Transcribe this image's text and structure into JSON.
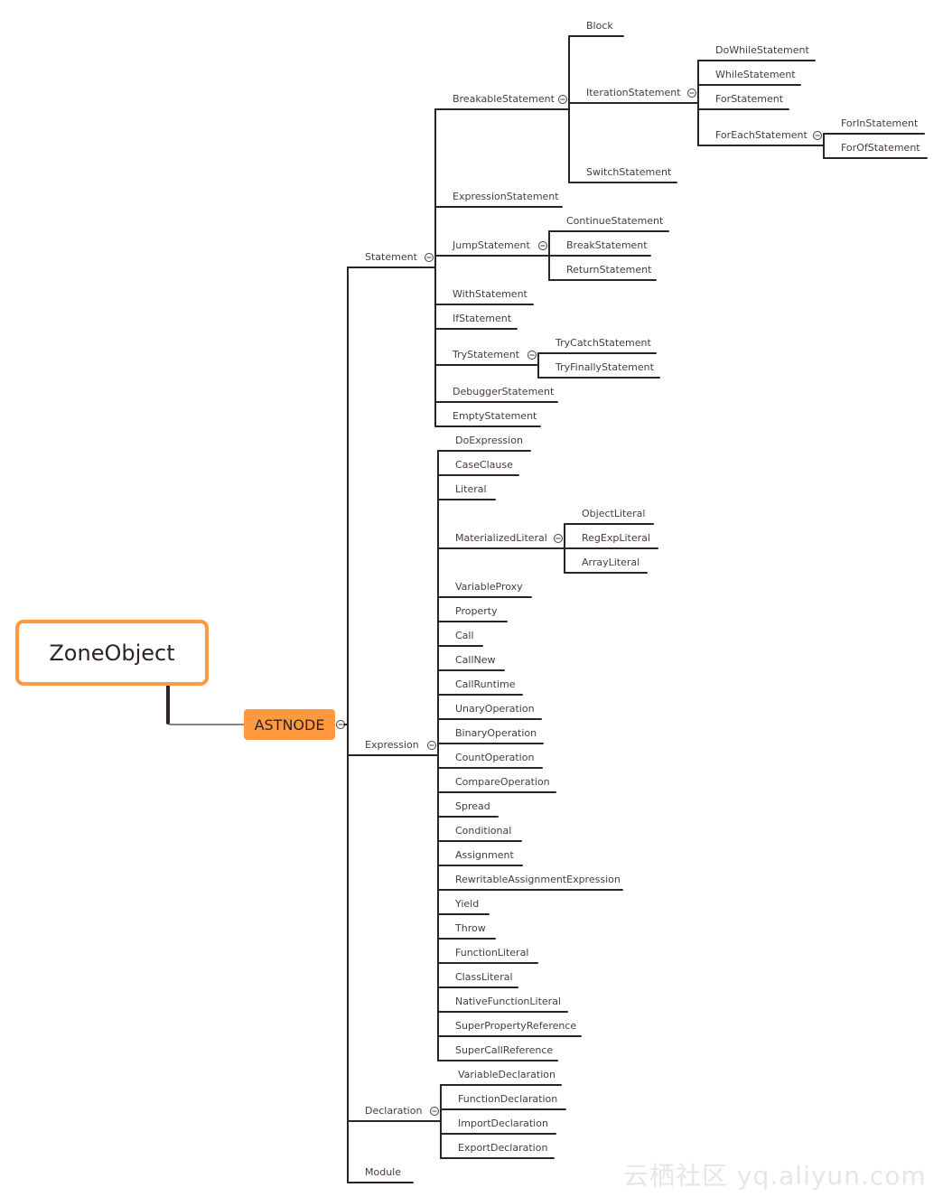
{
  "root": {
    "label": "ZoneObject",
    "border_color": "#ff9a40"
  },
  "main_topic": {
    "label": "ASTNODE",
    "fill_color": "#ff9a40"
  },
  "branches": [
    {
      "label": "Statement",
      "children": [
        {
          "label": "BreakableStatement",
          "children": [
            {
              "label": "Block"
            },
            {
              "label": "IterationStatement",
              "children": [
                {
                  "label": "DoWhileStatement"
                },
                {
                  "label": "WhileStatement"
                },
                {
                  "label": "ForStatement"
                },
                {
                  "label": "ForEachStatement",
                  "children": [
                    {
                      "label": "ForInStatement"
                    },
                    {
                      "label": "ForOfStatement"
                    }
                  ]
                }
              ]
            },
            {
              "label": "SwitchStatement"
            }
          ]
        },
        {
          "label": "ExpressionStatement"
        },
        {
          "label": "JumpStatement",
          "children": [
            {
              "label": "ContinueStatement"
            },
            {
              "label": "BreakStatement"
            },
            {
              "label": "ReturnStatement"
            }
          ]
        },
        {
          "label": "WithStatement"
        },
        {
          "label": "IfStatement"
        },
        {
          "label": "TryStatement",
          "children": [
            {
              "label": "TryCatchStatement"
            },
            {
              "label": "TryFinallyStatement"
            }
          ]
        },
        {
          "label": "DebuggerStatement"
        },
        {
          "label": "EmptyStatement"
        }
      ]
    },
    {
      "label": "Expression",
      "children": [
        {
          "label": "DoExpression"
        },
        {
          "label": "CaseClause"
        },
        {
          "label": "Literal"
        },
        {
          "label": "MaterializedLiteral",
          "children": [
            {
              "label": "ObjectLiteral"
            },
            {
              "label": "RegExpLiteral"
            },
            {
              "label": "ArrayLiteral"
            }
          ]
        },
        {
          "label": "VariableProxy"
        },
        {
          "label": "Property"
        },
        {
          "label": "Call"
        },
        {
          "label": "CallNew"
        },
        {
          "label": "CallRuntime"
        },
        {
          "label": "UnaryOperation"
        },
        {
          "label": "BinaryOperation"
        },
        {
          "label": "CountOperation"
        },
        {
          "label": "CompareOperation"
        },
        {
          "label": "Spread"
        },
        {
          "label": "Conditional"
        },
        {
          "label": "Assignment"
        },
        {
          "label": "RewritableAssignmentExpression"
        },
        {
          "label": "Yield"
        },
        {
          "label": "Throw"
        },
        {
          "label": "FunctionLiteral"
        },
        {
          "label": "ClassLiteral"
        },
        {
          "label": "NativeFunctionLiteral"
        },
        {
          "label": "SuperPropertyReference"
        },
        {
          "label": "SuperCallReference"
        }
      ]
    },
    {
      "label": "Declaration",
      "children": [
        {
          "label": "VariableDeclaration"
        },
        {
          "label": "FunctionDeclaration"
        },
        {
          "label": "ImportDeclaration"
        },
        {
          "label": "ExportDeclaration"
        }
      ]
    },
    {
      "label": "Module"
    }
  ],
  "watermark": "云栖社区 yq.aliyun.com",
  "line_color": "#2d2228"
}
